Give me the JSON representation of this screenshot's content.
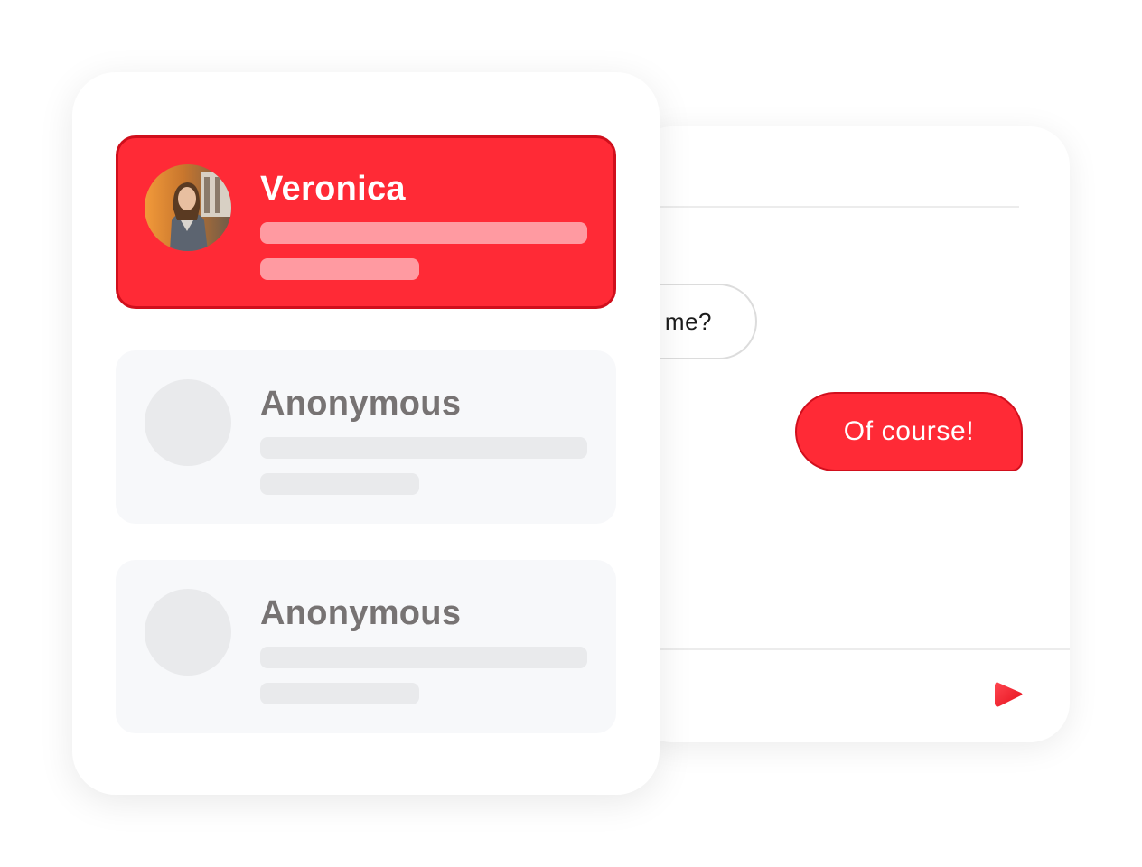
{
  "conversation": {
    "incoming_message": "me?",
    "outgoing_message": "Of course!",
    "send_icon": "send-icon"
  },
  "contacts": [
    {
      "name": "Veronica",
      "active": true,
      "avatar": "profile-photo"
    },
    {
      "name": "Anonymous",
      "active": false,
      "avatar": "placeholder-avatar"
    },
    {
      "name": "Anonymous",
      "active": false,
      "avatar": "placeholder-avatar"
    }
  ],
  "colors": {
    "accent": "#ff2a36",
    "accent_border": "#d00f1c",
    "muted_text": "#777373",
    "placeholder": "#e9eaec",
    "card_bg": "#f7f8fa"
  }
}
